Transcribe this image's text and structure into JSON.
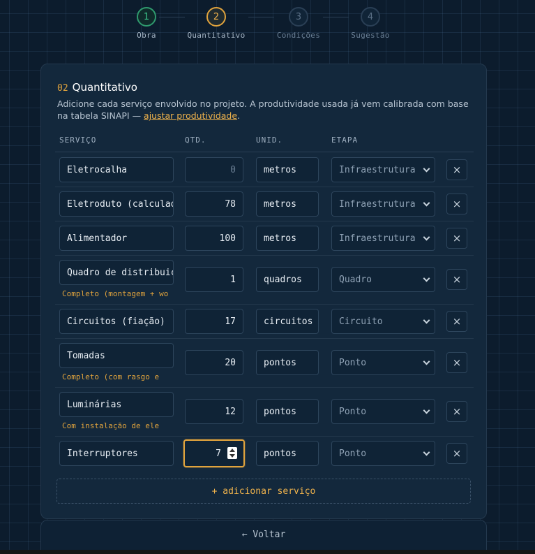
{
  "stepper": {
    "steps": [
      {
        "number": "1",
        "label": "Obra",
        "state": "done"
      },
      {
        "number": "2",
        "label": "Quantitativo",
        "state": "active"
      },
      {
        "number": "3",
        "label": "Condições",
        "state": "pending"
      },
      {
        "number": "4",
        "label": "Sugestão",
        "state": "pending"
      }
    ]
  },
  "card": {
    "number": "02",
    "title": "Quantitativo",
    "description_prefix": "Adicione cada serviço envolvido no projeto. A produtividade usada já vem calibrada com base na tabela SINAPI — ",
    "description_link": "ajustar produtividade",
    "description_suffix": "."
  },
  "table": {
    "headers": {
      "service": "SERVIÇO",
      "qty": "QTD.",
      "unit": "UNID.",
      "stage": "ETAPA"
    },
    "rows": [
      {
        "service": "Eletrocalha",
        "qty": "",
        "qty_placeholder": "0",
        "unit": "metros",
        "stage": "Infraestrutura",
        "note": ""
      },
      {
        "service": "Eletroduto (calculado)",
        "qty": "78",
        "unit": "metros",
        "stage": "Infraestrutura",
        "note": ""
      },
      {
        "service": "Alimentador",
        "qty": "100",
        "unit": "metros",
        "stage": "Infraestrutura",
        "note": ""
      },
      {
        "service": "Quadro de distribuição",
        "qty": "1",
        "unit": "quadros",
        "stage": "Quadro",
        "note": "Completo (montagem + wo"
      },
      {
        "service": "Circuitos (fiação)",
        "qty": "17",
        "unit": "circuitos",
        "stage": "Circuito",
        "note": ""
      },
      {
        "service": "Tomadas",
        "qty": "20",
        "unit": "pontos",
        "stage": "Ponto",
        "note": "Completo (com rasgo e"
      },
      {
        "service": "Luminárias",
        "qty": "12",
        "unit": "pontos",
        "stage": "Ponto",
        "note": "Com instalação de ele"
      },
      {
        "service": "Interruptores",
        "qty": "7",
        "unit": "pontos",
        "stage": "Ponto",
        "note": ""
      }
    ],
    "delete_glyph": "×"
  },
  "add_service_label": "+ adicionar serviço",
  "back_label": "← Voltar",
  "colors": {
    "accent": "#e0a33d",
    "done": "#3cc58b",
    "background": "#0c1c2d",
    "card": "#13283c"
  }
}
